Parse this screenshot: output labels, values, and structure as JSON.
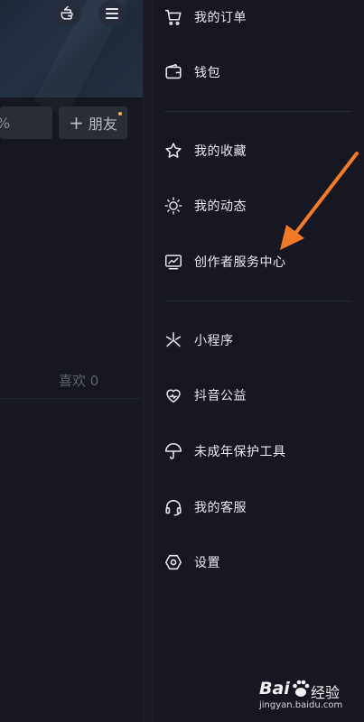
{
  "profile": {
    "percent_label": "%",
    "add_friend_label": "朋友",
    "add_friend_plus": "+",
    "likes_label": "喜欢 0"
  },
  "menu": {
    "items": [
      {
        "label": "我的订单",
        "icon": "cart-icon"
      },
      {
        "label": "钱包",
        "icon": "wallet-icon"
      },
      {
        "label": "我的收藏",
        "icon": "star-icon"
      },
      {
        "label": "我的动态",
        "icon": "sun-icon"
      },
      {
        "label": "创作者服务中心",
        "icon": "chart-monitor-icon"
      },
      {
        "label": "小程序",
        "icon": "asterisk-icon"
      },
      {
        "label": "抖音公益",
        "icon": "heart-icon"
      },
      {
        "label": "未成年保护工具",
        "icon": "umbrella-icon"
      },
      {
        "label": "我的客服",
        "icon": "headset-icon"
      },
      {
        "label": "设置",
        "icon": "hexagon-settings-icon"
      }
    ]
  },
  "watermark": {
    "brand": "Bai",
    "brand_suffix": "经验",
    "url": "jingyan.baidu.com"
  },
  "colors": {
    "accent_arrow": "#f27b2a",
    "notify_dot": "#f0b64b",
    "drawer_bg": "#161720"
  }
}
